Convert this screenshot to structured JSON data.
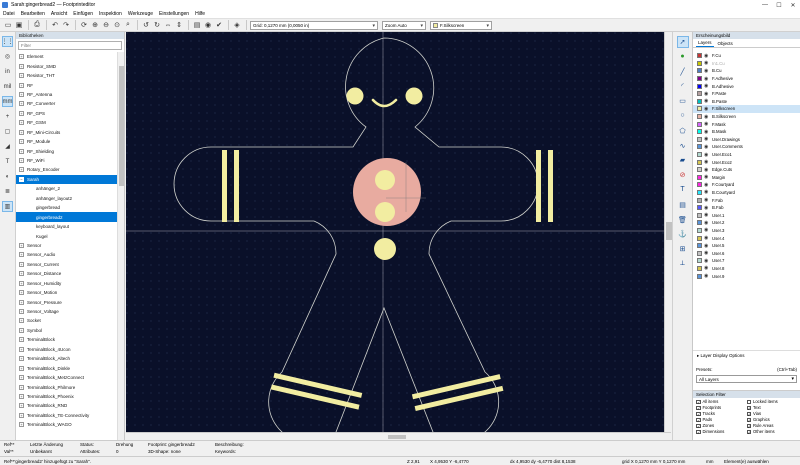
{
  "window": {
    "title": "Sarah:gingerbread2 — Footprinteditor",
    "minimize": "—",
    "maximize": "☐",
    "close": "✕"
  },
  "menu": [
    "Datei",
    "Bearbeiten",
    "Ansicht",
    "Einfügen",
    "Inspektion",
    "Werkzeuge",
    "Einstellungen",
    "Hilfe"
  ],
  "toolbar": {
    "grid": "Grid: 0,1270 mm (0,0050 in)",
    "zoom": "Zoom Auto",
    "layer": "F.Silkscreen"
  },
  "library": {
    "header": "Bibliotheken",
    "filter_placeholder": "Filter",
    "items": [
      {
        "label": "Element",
        "type": "folder",
        "expanded": false
      },
      {
        "label": "Resistor_SMD",
        "type": "folder",
        "expanded": false
      },
      {
        "label": "Resistor_THT",
        "type": "folder",
        "expanded": false
      },
      {
        "label": "RF",
        "type": "folder",
        "expanded": false
      },
      {
        "label": "RF_Antenna",
        "type": "folder",
        "expanded": false
      },
      {
        "label": "RF_Converter",
        "type": "folder",
        "expanded": false
      },
      {
        "label": "RF_GPS",
        "type": "folder",
        "expanded": false
      },
      {
        "label": "RF_GSM",
        "type": "folder",
        "expanded": false
      },
      {
        "label": "RF_Mini-Circuits",
        "type": "folder",
        "expanded": false
      },
      {
        "label": "RF_Module",
        "type": "folder",
        "expanded": false
      },
      {
        "label": "RF_Shielding",
        "type": "folder",
        "expanded": false
      },
      {
        "label": "RF_WiFi",
        "type": "folder",
        "expanded": false
      },
      {
        "label": "Rotary_Encoder",
        "type": "folder",
        "expanded": false
      },
      {
        "label": "Sarah",
        "type": "folder",
        "expanded": true,
        "selected": true
      },
      {
        "label": "anhänger_2",
        "type": "child"
      },
      {
        "label": "anhänger_layout2",
        "type": "child"
      },
      {
        "label": "gingerbread",
        "type": "child"
      },
      {
        "label": "gingerbread2",
        "type": "child",
        "selected": true
      },
      {
        "label": "keyboard_layout",
        "type": "child"
      },
      {
        "label": "Kugel",
        "type": "child"
      },
      {
        "label": "Sensor",
        "type": "folder",
        "expanded": false
      },
      {
        "label": "Sensor_Audio",
        "type": "folder",
        "expanded": false
      },
      {
        "label": "Sensor_Current",
        "type": "folder",
        "expanded": false
      },
      {
        "label": "Sensor_Distance",
        "type": "folder",
        "expanded": false
      },
      {
        "label": "Sensor_Humidity",
        "type": "folder",
        "expanded": false
      },
      {
        "label": "Sensor_Motion",
        "type": "folder",
        "expanded": false
      },
      {
        "label": "Sensor_Pressure",
        "type": "folder",
        "expanded": false
      },
      {
        "label": "Sensor_Voltage",
        "type": "folder",
        "expanded": false
      },
      {
        "label": "Socket",
        "type": "folder",
        "expanded": false
      },
      {
        "label": "Symbol",
        "type": "folder",
        "expanded": false
      },
      {
        "label": "TerminalBlock",
        "type": "folder",
        "expanded": false
      },
      {
        "label": "TerminalBlock_4Ucon",
        "type": "folder",
        "expanded": false
      },
      {
        "label": "TerminalBlock_Altech",
        "type": "folder",
        "expanded": false
      },
      {
        "label": "TerminalBlock_Dinkle",
        "type": "folder",
        "expanded": false
      },
      {
        "label": "TerminalBlock_MetzConnect",
        "type": "folder",
        "expanded": false
      },
      {
        "label": "TerminalBlock_Philmore",
        "type": "folder",
        "expanded": false
      },
      {
        "label": "TerminalBlock_Phoenix",
        "type": "folder",
        "expanded": false
      },
      {
        "label": "TerminalBlock_RND",
        "type": "folder",
        "expanded": false
      },
      {
        "label": "TerminalBlock_TE-Connectivity",
        "type": "folder",
        "expanded": false
      },
      {
        "label": "TerminalBlock_WAGO",
        "type": "folder",
        "expanded": false
      }
    ]
  },
  "appearance": {
    "header": "Erscheinungsbild",
    "tabs": [
      "Layers",
      "Objects"
    ],
    "layers": [
      {
        "name": "F.Cu",
        "color": "#c83434",
        "visible": true
      },
      {
        "name": "In1.Cu",
        "color": "#c8c800",
        "visible": true,
        "disabled": true
      },
      {
        "name": "B.Cu",
        "color": "#4d7fc4",
        "visible": true
      },
      {
        "name": "F.Adhesive",
        "color": "#84008b",
        "visible": true
      },
      {
        "name": "B.Adhesive",
        "color": "#0000ff",
        "visible": true
      },
      {
        "name": "F.Paste",
        "color": "#b4a0a0",
        "visible": true
      },
      {
        "name": "B.Paste",
        "color": "#00c2c2",
        "visible": true
      },
      {
        "name": "F.Silkscreen",
        "color": "#f2eda1",
        "visible": true,
        "highlight": true
      },
      {
        "name": "B.Silkscreen",
        "color": "#e8b2a7",
        "visible": true
      },
      {
        "name": "F.Mask",
        "color": "#d864ff",
        "visible": true
      },
      {
        "name": "B.Mask",
        "color": "#02ffee",
        "visible": true
      },
      {
        "name": "User.Drawings",
        "color": "#c2c2c2",
        "visible": true
      },
      {
        "name": "User.Comments",
        "color": "#5994dc",
        "visible": true
      },
      {
        "name": "User.Eco1",
        "color": "#b4dbd2",
        "visible": true
      },
      {
        "name": "User.Eco2",
        "color": "#d8c852",
        "visible": true
      },
      {
        "name": "Edge.Cuts",
        "color": "#d0d2cd",
        "visible": true
      },
      {
        "name": "Margin",
        "color": "#ff26e2",
        "visible": true
      },
      {
        "name": "F.Courtyard",
        "color": "#ff26e2",
        "visible": true
      },
      {
        "name": "B.Courtyard",
        "color": "#26e9ff",
        "visible": true
      },
      {
        "name": "F.Fab",
        "color": "#afafaf",
        "visible": true
      },
      {
        "name": "B.Fab",
        "color": "#5858ff",
        "visible": true
      },
      {
        "name": "User.1",
        "color": "#c2c2c2",
        "visible": true
      },
      {
        "name": "User.2",
        "color": "#5994dc",
        "visible": true
      },
      {
        "name": "User.3",
        "color": "#b4dbd2",
        "visible": true
      },
      {
        "name": "User.4",
        "color": "#d8c852",
        "visible": true
      },
      {
        "name": "User.5",
        "color": "#5994dc",
        "visible": true
      },
      {
        "name": "User.6",
        "color": "#c2c2c2",
        "visible": true
      },
      {
        "name": "User.7",
        "color": "#b4dbd2",
        "visible": true
      },
      {
        "name": "User.8",
        "color": "#d8c852",
        "visible": true
      },
      {
        "name": "User.9",
        "color": "#5994dc",
        "visible": true
      }
    ],
    "display_options": "▸ Layer Display Options"
  },
  "presets": {
    "label": "Presets:",
    "shortcut": "(Ctrl+Tab)",
    "value": "All Layers"
  },
  "selection_filter": {
    "header": "Selection Filter",
    "items": [
      {
        "label": "All items",
        "checked": true
      },
      {
        "label": "Locked items",
        "checked": false
      },
      {
        "label": "Footprints",
        "checked": true
      },
      {
        "label": "Text",
        "checked": true
      },
      {
        "label": "Tracks",
        "checked": true
      },
      {
        "label": "Vias",
        "checked": true
      },
      {
        "label": "Pads",
        "checked": true
      },
      {
        "label": "Graphics",
        "checked": true
      },
      {
        "label": "Zones",
        "checked": true
      },
      {
        "label": "Rule Areas",
        "checked": true
      },
      {
        "label": "Dimensions",
        "checked": true
      },
      {
        "label": "Other items",
        "checked": true
      }
    ]
  },
  "info": {
    "ref_label": "Ref**",
    "val_label": "Val**",
    "last_change_label": "Letzte Änderung",
    "last_change_value": "Unbekannt",
    "status_label": "Status:",
    "attributes_label": "Attributes:",
    "rotation_label": "Drehung",
    "rotation_value": "0",
    "footprint": "Footprint: gingerbread2",
    "shape3d": "3D-Shape: none",
    "description_label": "Beschreibung:",
    "keywords_label": "Keywords:"
  },
  "status": {
    "message": "Ref**'gingerbread2' hinzugefügt zu \"Sarah\".",
    "zoom": "Z 2,91",
    "xy": "X 4,9530  Y -6,4770",
    "dxdy": "dx 4,9530  dy -6,4770  dist 8,1538",
    "grid": "grid X 0,1270 mm  Y 0,1270 mm",
    "units": "mm",
    "mode": "Element(e) auswählen"
  },
  "colors": {
    "canvas_bg": "#0a1029",
    "silkscreen": "#f2eda1",
    "paste": "#e8aba0",
    "edge": "#d0d2cd",
    "selection": "#0078d7"
  }
}
